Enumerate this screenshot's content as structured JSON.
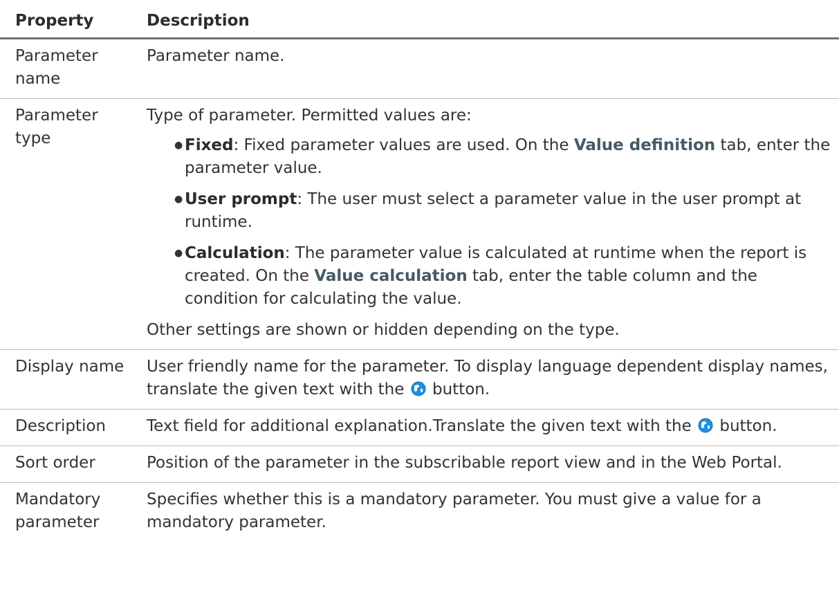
{
  "table": {
    "headers": {
      "property": "Property",
      "description": "Description"
    },
    "rows": {
      "parameter_name": {
        "property": "Parameter name",
        "description": "Parameter name."
      },
      "parameter_type": {
        "property": "Parameter type",
        "intro": "Type of parameter. Permitted values are:",
        "values": [
          {
            "term": "Fixed",
            "text_before": ": Fixed parameter values are used. On the ",
            "ref": "Value definition",
            "text_after": " tab, enter the parameter value."
          },
          {
            "term": "User prompt",
            "text_before": ": The user must select a parameter value in the user prompt at runtime.",
            "ref": "",
            "text_after": ""
          },
          {
            "term": "Calculation",
            "text_before": ": The parameter value is calculated at runtime when the report is created. On the ",
            "ref": "Value calculation",
            "text_after": " tab, enter the table column and the condition for calculating the value."
          }
        ],
        "outro": "Other settings are shown or hidden depending on the type."
      },
      "display_name": {
        "property": "Display name",
        "description_before": "User friendly name for the parameter. To display language dependent display names, translate the given text with the ",
        "description_after": " button.",
        "icon": "translate-globe-icon"
      },
      "description": {
        "property": "Description",
        "description_before": "Text field for additional explanation.Translate the given text with the ",
        "description_after": " button.",
        "icon": "translate-globe-icon"
      },
      "sort_order": {
        "property": "Sort order",
        "description": "Position of the parameter in the subscribable report view and in the Web Portal."
      },
      "mandatory_parameter": {
        "property": "Mandatory parameter",
        "description": "Specifies whether this is a mandatory parameter. You must give a value for a mandatory parameter."
      }
    }
  },
  "colors": {
    "text": "#333333",
    "reference": "#455a65",
    "header_rule": "#6f7177",
    "row_rule": "#b9bbbe",
    "icon_blue": "#1f8fe0"
  }
}
